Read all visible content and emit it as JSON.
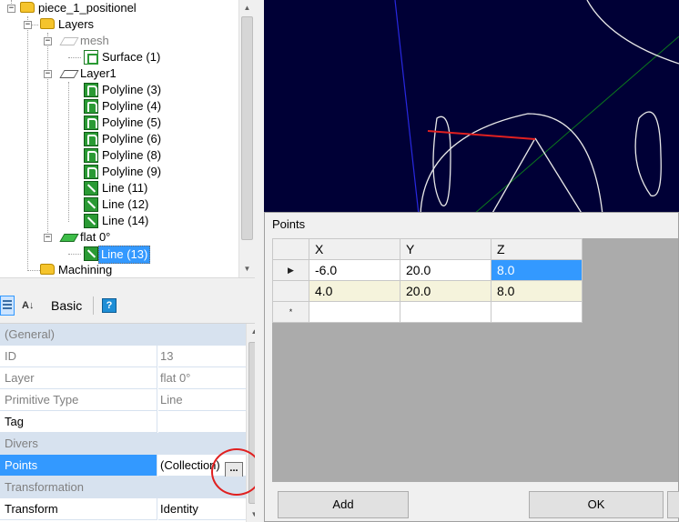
{
  "tree": {
    "items": [
      {
        "label": "piece_1_positionel",
        "icon": "folder-icon"
      },
      {
        "label": "Layers",
        "icon": "folder-icon"
      },
      {
        "label": "mesh",
        "icon": "layer-icon"
      },
      {
        "label": "Surface (1)",
        "icon": "surface-icon"
      },
      {
        "label": "Layer1",
        "icon": "layer-icon"
      },
      {
        "label": "Polyline (3)",
        "icon": "polyline-icon"
      },
      {
        "label": "Polyline (4)",
        "icon": "polyline-icon"
      },
      {
        "label": "Polyline (5)",
        "icon": "polyline-icon"
      },
      {
        "label": "Polyline (6)",
        "icon": "polyline-icon"
      },
      {
        "label": "Polyline (8)",
        "icon": "polyline-icon"
      },
      {
        "label": "Polyline (9)",
        "icon": "polyline-icon"
      },
      {
        "label": "Line (11)",
        "icon": "line-icon"
      },
      {
        "label": "Line (12)",
        "icon": "line-icon"
      },
      {
        "label": "Line (14)",
        "icon": "line-icon"
      },
      {
        "label": "flat 0°",
        "icon": "layer-icon"
      },
      {
        "label": "Line (13)",
        "icon": "line-icon"
      },
      {
        "label": "Machining",
        "icon": "folder-icon"
      }
    ],
    "expander_minus": "−"
  },
  "toolbar": {
    "alpha_label": "A↓",
    "basic_label": "Basic",
    "help_label": "?"
  },
  "properties": {
    "cat_general": "(General)",
    "rows_general": [
      {
        "name": "ID",
        "value": "13"
      },
      {
        "name": "Layer",
        "value": "flat 0°"
      },
      {
        "name": "Primitive Type",
        "value": "Line"
      },
      {
        "name": "Tag",
        "value": ""
      }
    ],
    "cat_divers": "Divers",
    "points": {
      "name": "Points",
      "value": "(Collection)",
      "ellipsis": "..."
    },
    "cat_transformation": "Transformation",
    "transform": {
      "name": "Transform",
      "value": "Identity"
    }
  },
  "points_dialog": {
    "title": "Points",
    "columns": [
      "X",
      "Y",
      "Z"
    ],
    "rows": [
      {
        "marker": "▶",
        "values": [
          "-6.0",
          "20.0",
          "8.0"
        ]
      },
      {
        "marker": "",
        "values": [
          "4.0",
          "20.0",
          "8.0"
        ]
      },
      {
        "marker": "*",
        "values": [
          "",
          "",
          ""
        ]
      }
    ],
    "add_label": "Add",
    "ok_label": "OK"
  },
  "colors": {
    "viewport_bg": "#000036",
    "selection": "#3399ff",
    "highlight_circle": "#e02020"
  }
}
